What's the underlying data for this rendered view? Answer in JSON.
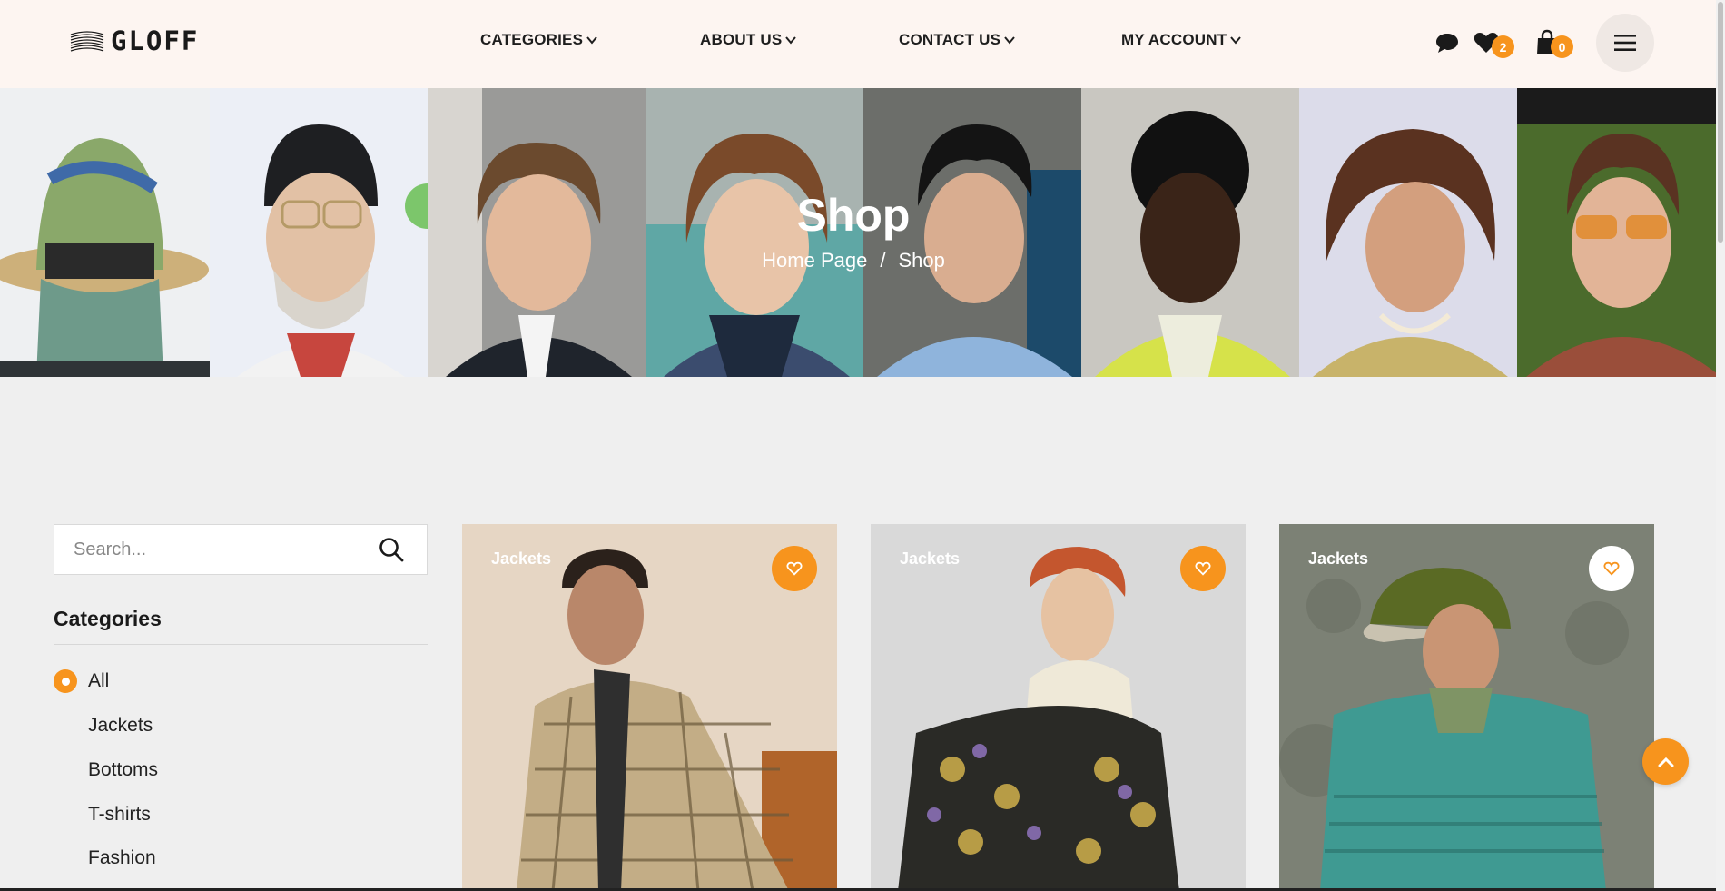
{
  "brand": {
    "name": "GLOFF"
  },
  "nav": [
    {
      "label": "CATEGORIES"
    },
    {
      "label": "ABOUT US"
    },
    {
      "label": "CONTACT US"
    },
    {
      "label": "MY ACCOUNT"
    }
  ],
  "header_actions": {
    "chat_icon": "chat-bubble-icon",
    "wishlist_count": "2",
    "cart_count": "0",
    "menu_icon": "hamburger-icon"
  },
  "banner": {
    "title": "Shop",
    "breadcrumb": [
      "Home Page",
      "/",
      "Shop"
    ]
  },
  "sidebar": {
    "search_placeholder": "Search...",
    "categories_title": "Categories",
    "categories": [
      "All",
      "Jackets",
      "Bottoms",
      "T-shirts",
      "Fashion"
    ],
    "selected": "All"
  },
  "products": [
    {
      "category": "Jackets",
      "wishlisted": true
    },
    {
      "category": "Jackets",
      "wishlisted": true
    },
    {
      "category": "Jackets",
      "wishlisted": false
    }
  ],
  "colors": {
    "accent": "#f7941d",
    "header_bg": "#fdf5f1",
    "page_bg": "#efefef"
  }
}
